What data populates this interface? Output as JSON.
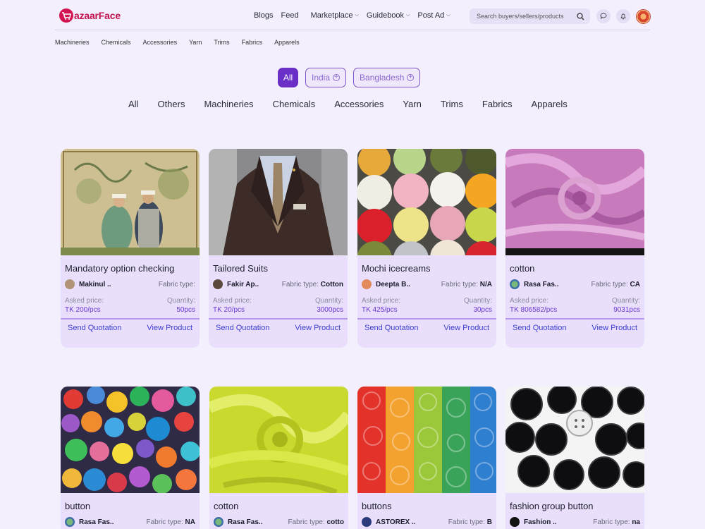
{
  "header": {
    "logo_text": "azaarFace",
    "nav": {
      "blogs": "Blogs",
      "feed": "Feed",
      "marketplace": "Marketplace",
      "guidebook": "Guidebook",
      "post_ad": "Post Ad"
    },
    "search_placeholder": "Search buyers/sellers/products",
    "icons": [
      "chat-icon",
      "bell-icon"
    ]
  },
  "subnav": [
    "Machineries",
    "Chemicals",
    "Accessories",
    "Yarn",
    "Trims",
    "Fabrics",
    "Apparels"
  ],
  "filters": {
    "all": "All",
    "india": "India",
    "bangladesh": "Bangladesh",
    "active": "All"
  },
  "categories": [
    "All",
    "Others",
    "Machineries",
    "Chemicals",
    "Accessories",
    "Yarn",
    "Trims",
    "Fabrics",
    "Apparels"
  ],
  "labels": {
    "fabric_type": "Fabric type:",
    "asked_price": "Asked price:",
    "quantity": "Quantity:",
    "send_quotation": "Send Quotation",
    "view_product": "View Product"
  },
  "products": [
    {
      "title": "Mandatory option checking",
      "seller": "Makinul ..",
      "fabric_type": "",
      "price": "TK 200/pcs",
      "quantity": "50pcs"
    },
    {
      "title": "Tailored Suits",
      "seller": "Fakir Ap..",
      "fabric_type": "Cotton",
      "price": "TK 20/pcs",
      "quantity": "3000pcs"
    },
    {
      "title": "Mochi icecreams",
      "seller": "Deepta B..",
      "fabric_type": "N/A",
      "price": "TK 425/pcs",
      "quantity": "30pcs"
    },
    {
      "title": "cotton",
      "seller": "Rasa Fas..",
      "fabric_type": "CA",
      "price": "TK 806582/pcs",
      "quantity": "9031pcs"
    },
    {
      "title": "button",
      "seller": "Rasa Fas..",
      "fabric_type": "NA"
    },
    {
      "title": "cotton",
      "seller": "Rasa Fas..",
      "fabric_type": "cotto"
    },
    {
      "title": "buttons",
      "seller": "ASTOREX ..",
      "fabric_type": "B"
    },
    {
      "title": "fashion group button",
      "seller": "Fashion ..",
      "fabric_type": "na"
    }
  ]
}
